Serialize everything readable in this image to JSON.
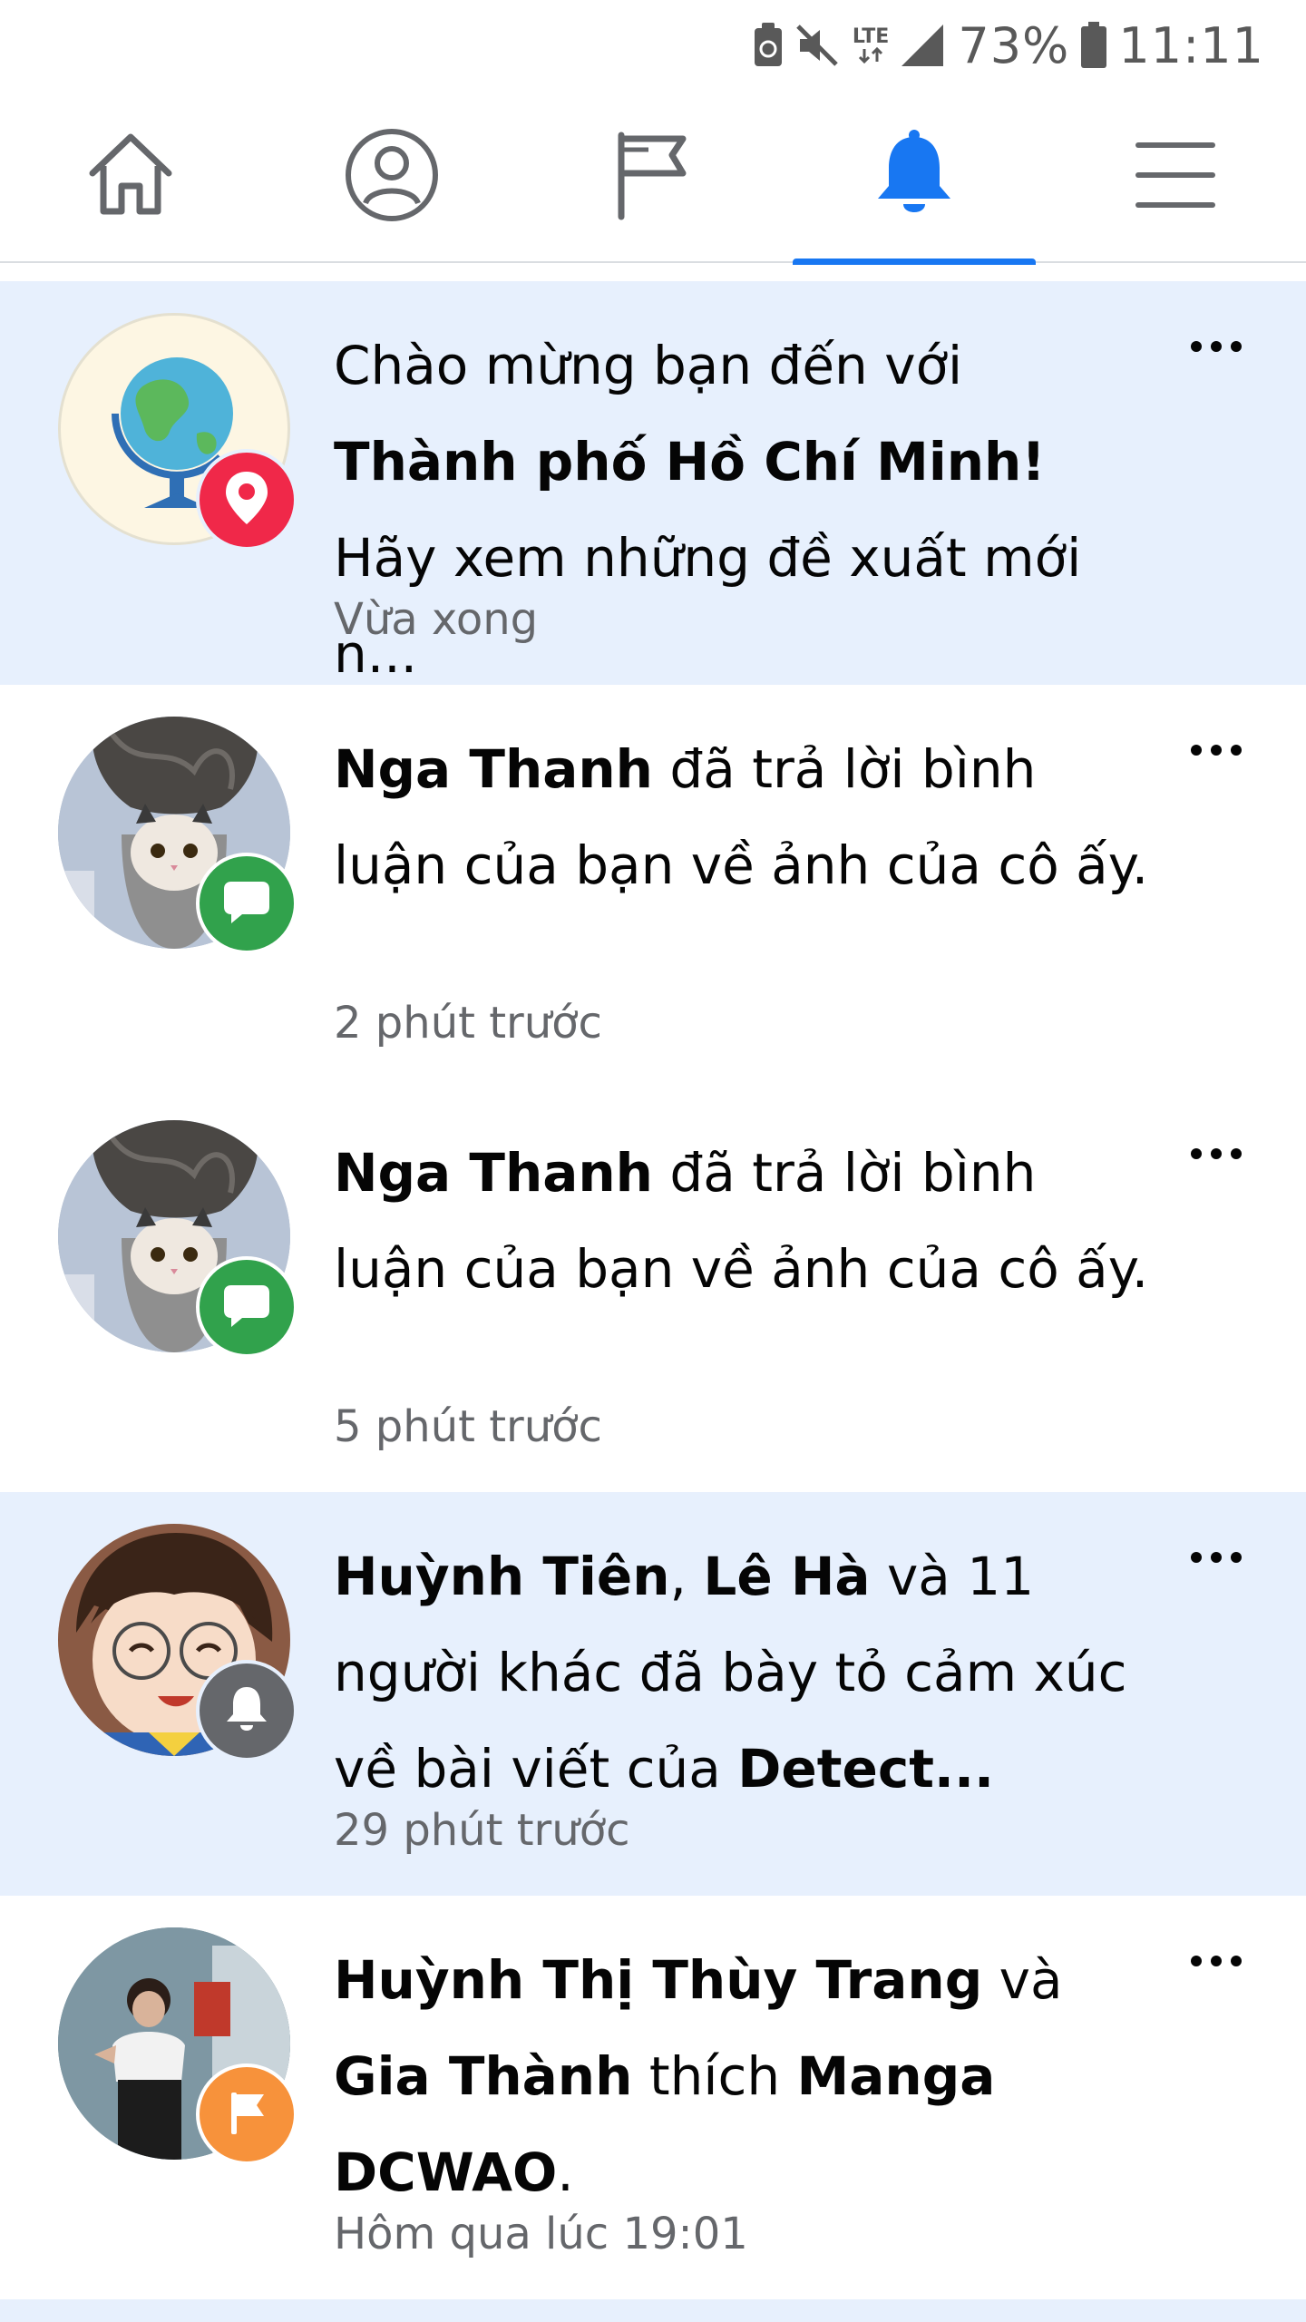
{
  "status_bar": {
    "network": "LTE",
    "battery_percent": "73%",
    "time": "11:11"
  },
  "nav": {
    "tabs": [
      {
        "icon": "home-icon",
        "active": false
      },
      {
        "icon": "profile-icon",
        "active": false
      },
      {
        "icon": "pages-flag-icon",
        "active": false
      },
      {
        "icon": "bell-icon",
        "active": true
      },
      {
        "icon": "menu-icon",
        "active": false
      }
    ]
  },
  "notifications": [
    {
      "parts": [
        {
          "t": "Chào mừng bạn đến với ",
          "b": false
        },
        {
          "t": "Thành phố Hồ Chí Minh!",
          "b": true
        },
        {
          "t": " Hãy xem những đề xuất mới n...",
          "b": false
        }
      ],
      "time": "Vừa xong",
      "badge_icon": "location-pin-icon",
      "badge_color": "#f02849",
      "unread": true
    },
    {
      "parts": [
        {
          "t": "Nga Thanh",
          "b": true
        },
        {
          "t": " đã trả lời bình luận của bạn về ảnh của cô ấy.",
          "b": false
        }
      ],
      "time": "2 phút trước",
      "badge_icon": "comment-icon",
      "badge_color": "#31a24c",
      "unread": false
    },
    {
      "parts": [
        {
          "t": "Nga Thanh",
          "b": true
        },
        {
          "t": " đã trả lời bình luận của bạn về ảnh của cô ấy.",
          "b": false
        }
      ],
      "time": "5 phút trước",
      "badge_icon": "comment-icon",
      "badge_color": "#31a24c",
      "unread": false
    },
    {
      "parts": [
        {
          "t": "Huỳnh Tiên",
          "b": true
        },
        {
          "t": ", ",
          "b": false
        },
        {
          "t": "Lê Hà",
          "b": true
        },
        {
          "t": " và 11 người khác đã bày tỏ cảm xúc về bài viết của ",
          "b": false
        },
        {
          "t": "Detect...",
          "b": true
        }
      ],
      "time": "29 phút trước",
      "badge_icon": "bell-icon",
      "badge_color": "#65676b",
      "unread": true
    },
    {
      "parts": [
        {
          "t": "Huỳnh Thị Thùy Trang",
          "b": true
        },
        {
          "t": " và ",
          "b": false
        },
        {
          "t": "Gia Thành",
          "b": true
        },
        {
          "t": " thích ",
          "b": false
        },
        {
          "t": "Manga DCWAO",
          "b": true
        },
        {
          "t": ".",
          "b": false
        }
      ],
      "time": "Hôm qua lúc 19:01",
      "badge_icon": "flag-icon",
      "badge_color": "#f7923b",
      "unread": false
    }
  ],
  "colors": {
    "accent": "#1877f2",
    "unread_bg": "#e7f0fd",
    "secondary_text": "#65676b"
  }
}
